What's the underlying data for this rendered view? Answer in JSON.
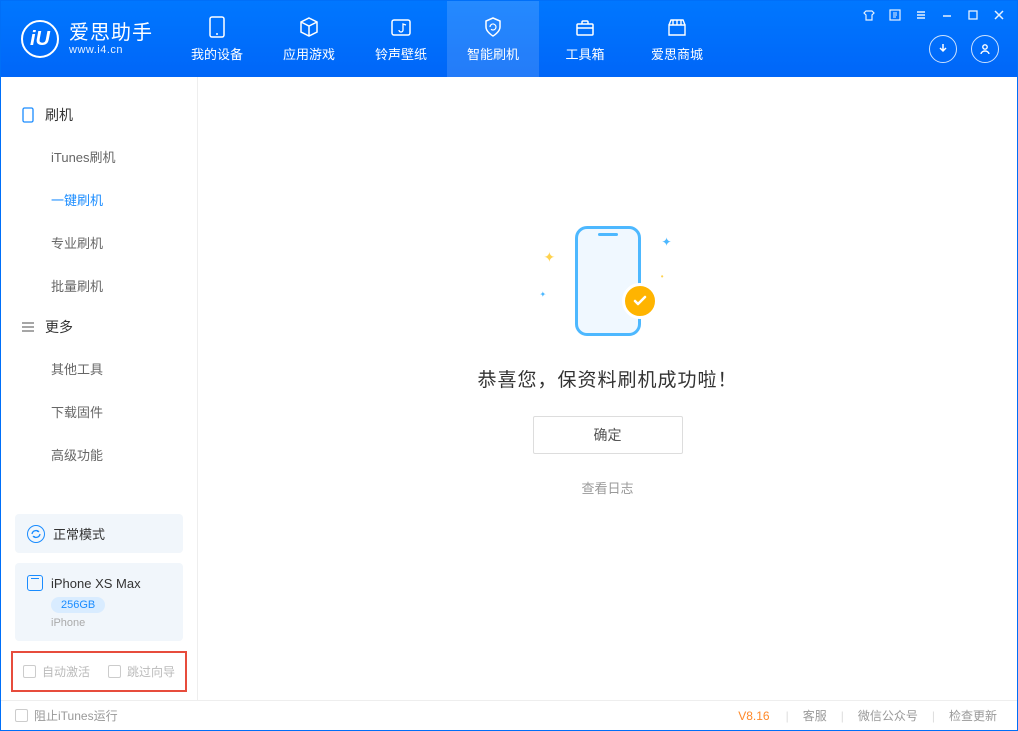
{
  "app": {
    "title": "爱思助手",
    "subtitle": "www.i4.cn",
    "logo_letter": "iU"
  },
  "nav": {
    "tabs": [
      {
        "label": "我的设备"
      },
      {
        "label": "应用游戏"
      },
      {
        "label": "铃声壁纸"
      },
      {
        "label": "智能刷机"
      },
      {
        "label": "工具箱"
      },
      {
        "label": "爱思商城"
      }
    ],
    "active_index": 3
  },
  "sidebar": {
    "sections": [
      {
        "title": "刷机",
        "items": [
          "iTunes刷机",
          "一键刷机",
          "专业刷机",
          "批量刷机"
        ],
        "active_index": 1
      },
      {
        "title": "更多",
        "items": [
          "其他工具",
          "下载固件",
          "高级功能"
        ],
        "active_index": -1
      }
    ],
    "status_mode": "正常模式",
    "device": {
      "name": "iPhone XS Max",
      "storage": "256GB",
      "type": "iPhone"
    },
    "checks": {
      "auto_activate": "自动激活",
      "skip_guide": "跳过向导"
    }
  },
  "main": {
    "success_text": "恭喜您，保资料刷机成功啦！",
    "ok_label": "确定",
    "log_link": "查看日志"
  },
  "footer": {
    "block_itunes": "阻止iTunes运行",
    "version": "V8.16",
    "links": [
      "客服",
      "微信公众号",
      "检查更新"
    ]
  }
}
